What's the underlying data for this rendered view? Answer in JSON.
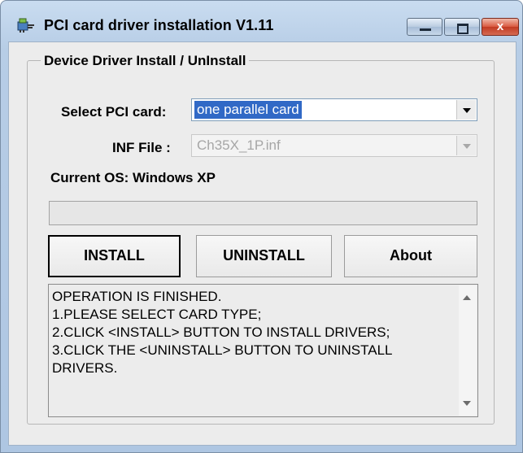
{
  "window": {
    "title": "PCI card driver installation V1.11",
    "icons": {
      "app": "network-card-icon",
      "minimize": "minimize-icon",
      "maximize": "maximize-icon",
      "close": "close-icon"
    },
    "close_glyph": "x"
  },
  "group": {
    "legend": "Device Driver Install / UnInstall"
  },
  "pci_card": {
    "label": "Select PCI card:",
    "value": "one parallel card"
  },
  "inf_file": {
    "label": "INF File :",
    "value": "Ch35X_1P.inf"
  },
  "os": {
    "text": "Current OS: Windows XP"
  },
  "progress": {
    "value": 0
  },
  "buttons": {
    "install": "INSTALL",
    "uninstall": "UNINSTALL",
    "about": "About"
  },
  "log": {
    "lines": [
      "OPERATION IS FINISHED.",
      "1.PLEASE SELECT CARD TYPE;",
      "2.CLICK <INSTALL> BUTTON TO INSTALL DRIVERS;",
      "3.CLICK THE <UNINSTALL> BUTTON TO UNINSTALL DRIVERS."
    ]
  },
  "colors": {
    "selection": "#3169c6",
    "title_bar": "#b7cde6",
    "close_button": "#d9583f"
  }
}
